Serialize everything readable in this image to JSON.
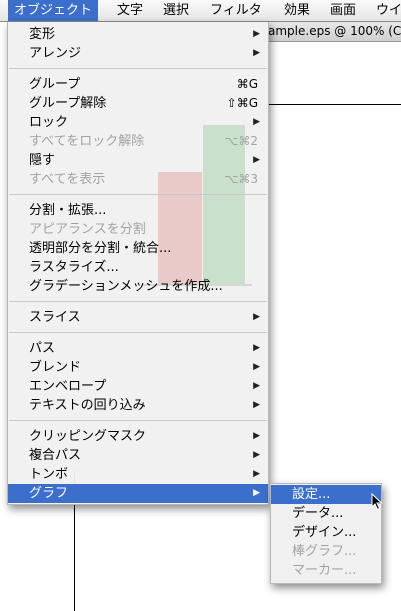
{
  "menubar": {
    "items": [
      {
        "label": "オブジェクト"
      },
      {
        "label": "文字"
      },
      {
        "label": "選択"
      },
      {
        "label": "フィルタ"
      },
      {
        "label": "効果"
      },
      {
        "label": "画面"
      },
      {
        "label": "ウイ"
      }
    ]
  },
  "document": {
    "title": "ample.eps @ 100% (C"
  },
  "menu": {
    "items": [
      {
        "label": "変形"
      },
      {
        "label": "アレンジ"
      },
      {
        "label": "グループ",
        "shortcut": "⌘G"
      },
      {
        "label": "グループ解除",
        "shortcut": "⇧⌘G"
      },
      {
        "label": "ロック"
      },
      {
        "label": "すべてをロック解除",
        "shortcut": "⌥⌘2"
      },
      {
        "label": "隠す"
      },
      {
        "label": "すべてを表示",
        "shortcut": "⌥⌘3"
      },
      {
        "label": "分割・拡張..."
      },
      {
        "label": "アピアランスを分割"
      },
      {
        "label": "透明部分を分割・統合..."
      },
      {
        "label": "ラスタライズ..."
      },
      {
        "label": "グラデーションメッシュを作成..."
      },
      {
        "label": "スライス"
      },
      {
        "label": "パス"
      },
      {
        "label": "ブレンド"
      },
      {
        "label": "エンベロープ"
      },
      {
        "label": "テキストの回り込み"
      },
      {
        "label": "クリッピングマスク"
      },
      {
        "label": "複合パス"
      },
      {
        "label": "トンボ"
      },
      {
        "label": "グラフ"
      }
    ]
  },
  "submenu": {
    "items": [
      {
        "label": "設定..."
      },
      {
        "label": "データ..."
      },
      {
        "label": "デザイン..."
      },
      {
        "label": "棒グラフ..."
      },
      {
        "label": "マーカー..."
      }
    ]
  }
}
